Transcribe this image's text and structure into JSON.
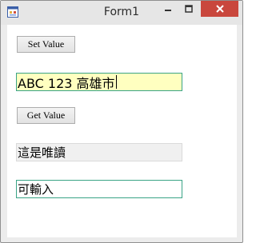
{
  "window": {
    "title": "Form1"
  },
  "controls": {
    "set_button_label": "Set Value",
    "text_input_1_value": "ABC 123 高雄市",
    "get_button_label": "Get Value",
    "readonly_field_value": "這是唯讀",
    "text_input_2_value": "可輸入"
  },
  "colors": {
    "close_button_bg": "#c9473d",
    "input_highlight_bg": "#ffffc0",
    "readonly_bg": "#f0f0f0",
    "focus_border": "#3aa486"
  },
  "icons": {
    "app": "app-icon",
    "minimize": "minimize-icon",
    "maximize": "maximize-icon",
    "close": "close-icon"
  }
}
